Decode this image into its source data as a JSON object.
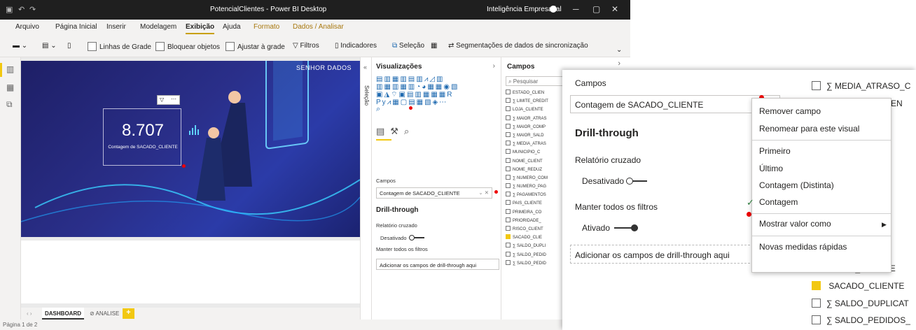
{
  "window": {
    "title": "PotencialClientes - Power BI Desktop",
    "user": "Inteligência Empresarial"
  },
  "menu": [
    "Arquivo",
    "Página Inicial",
    "Inserir",
    "Modelagem",
    "Exibição",
    "Ajuda",
    "Formato",
    "Dados / Analisar"
  ],
  "ribbon": {
    "grid": "Linhas de Grade",
    "lock": "Bloquear objetos",
    "snap": "Ajustar à grade",
    "filters": "Filtros",
    "bookmarks": "Indicadores",
    "selection": "Seleção",
    "sync": "Segmentações de dados de sincronização"
  },
  "report": {
    "logo": "SENHOR DADOS",
    "card_value": "8.707",
    "card_label": "Contagem de SACADO_CLIENTE"
  },
  "tabs": {
    "dashboard": "DASHBOARD",
    "analise": "ANALISE",
    "add": "+"
  },
  "status": "Página 1 de 2",
  "vis": {
    "header": "Visualizações",
    "selection": "Seleção",
    "fields_label": "Campos",
    "field_value": "Contagem de SACADO_CLIENTE",
    "drill": "Drill-through",
    "cross": "Relatório cruzado",
    "off": "Desativado",
    "keep": "Manter todos os filtros",
    "on": "Ativado",
    "drop": "Adicionar os campos de drill-through aqui"
  },
  "campos": {
    "header": "Campos",
    "search": "Pesquisar",
    "items": [
      {
        "t": "ESTADO_CLIEN",
        "s": false,
        "c": false
      },
      {
        "t": "LIMITE_CREDIT",
        "s": true,
        "c": false
      },
      {
        "t": "LOJA_CLIENTE",
        "s": false,
        "c": false
      },
      {
        "t": "MAIOR_ATRAS",
        "s": true,
        "c": false
      },
      {
        "t": "MAIOR_COMP",
        "s": true,
        "c": false
      },
      {
        "t": "MAIOR_SALD",
        "s": true,
        "c": false
      },
      {
        "t": "MEDIA_ATRAS",
        "s": true,
        "c": false
      },
      {
        "t": "MUNICIPIO_C",
        "s": false,
        "c": false
      },
      {
        "t": "NOME_CLIENT",
        "s": false,
        "c": false
      },
      {
        "t": "NOME_REDUZ",
        "s": false,
        "c": false
      },
      {
        "t": "NUMERO_COM",
        "s": true,
        "c": false
      },
      {
        "t": "NUMERO_PAG",
        "s": true,
        "c": false
      },
      {
        "t": "PAGAMENTOS",
        "s": true,
        "c": false
      },
      {
        "t": "PAIS_CLIENTE",
        "s": false,
        "c": false
      },
      {
        "t": "PRIMEIRA_CO",
        "s": false,
        "c": false
      },
      {
        "t": "PRIORIDADE_",
        "s": false,
        "c": false
      },
      {
        "t": "RISCO_CLIENT",
        "s": false,
        "c": false
      },
      {
        "t": "SACADO_CLIE",
        "s": false,
        "c": true
      },
      {
        "t": "SALDO_DUPLI",
        "s": true,
        "c": false
      },
      {
        "t": "SALDO_PEDID",
        "s": true,
        "c": false
      },
      {
        "t": "SALDO_PEDID",
        "s": true,
        "c": false
      }
    ]
  },
  "zoom": {
    "campos": "Campos",
    "field": "Contagem de SACADO_CLIENTE",
    "drill": "Drill-through",
    "cross": "Relatório cruzado",
    "off": "Desativado",
    "keep": "Manter todos os filtros",
    "on": "Ativado",
    "drop": "Adicionar os campos de drill-through aqui",
    "list": [
      {
        "t": "MEDIA_ATRASO_C",
        "s": true,
        "c": false
      },
      {
        "t": "MUNICIPIO_CLIEN",
        "s": false,
        "c": false
      },
      {
        "t": "RISCO_CLIENTE",
        "s": false,
        "c": false
      },
      {
        "t": "SACADO_CLIENTE",
        "s": false,
        "c": true
      },
      {
        "t": "SALDO_DUPLICAT",
        "s": true,
        "c": false
      },
      {
        "t": "SALDO_PEDIDOS_",
        "s": true,
        "c": false
      }
    ],
    "menu": {
      "remove": "Remover campo",
      "rename": "Renomear para este visual",
      "first": "Primeiro",
      "last": "Último",
      "distinct": "Contagem (Distinta)",
      "count": "Contagem",
      "show": "Mostrar valor como",
      "quick": "Novas medidas rápidas"
    }
  },
  "colors": {
    "accent": "#f2c811",
    "report_bg": "#23287a",
    "red": "#e00000"
  }
}
